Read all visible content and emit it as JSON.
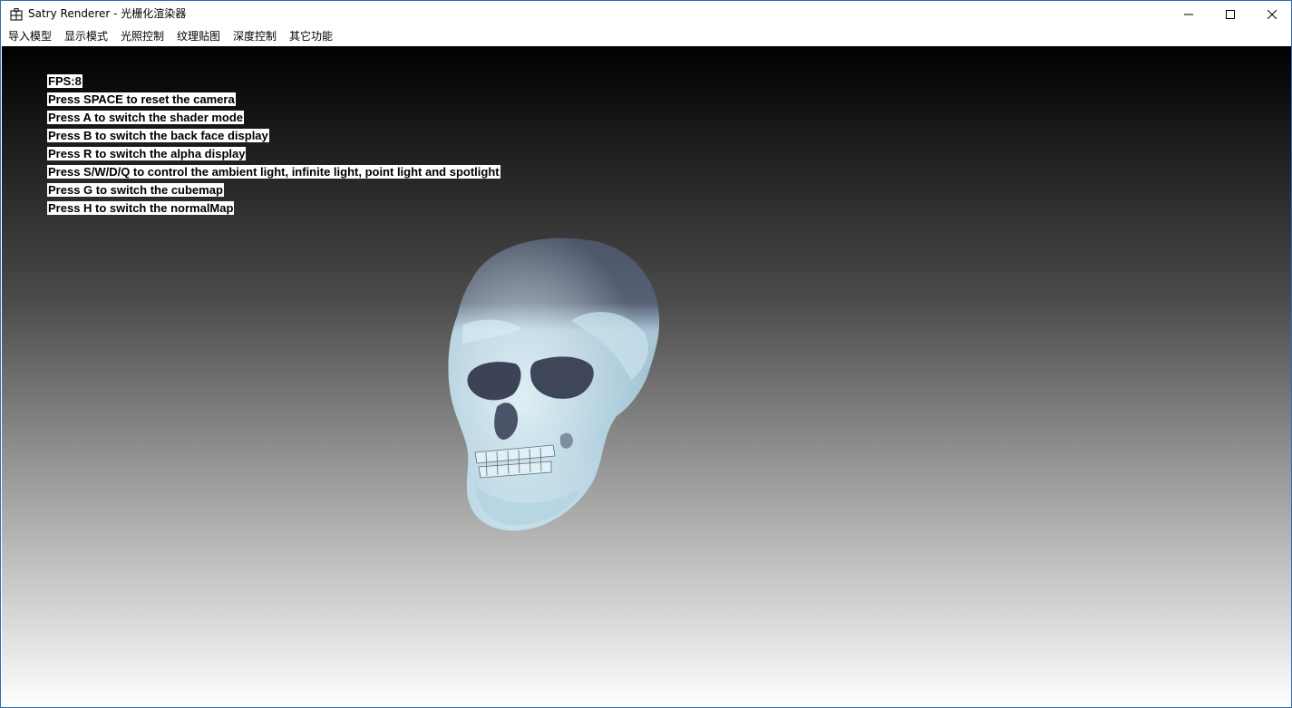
{
  "window": {
    "title": "Satry Renderer - 光栅化渲染器",
    "app_icon": "app-window-icon",
    "controls": {
      "minimize_icon": "minimize-icon",
      "maximize_icon": "maximize-icon",
      "close_icon": "close-icon"
    }
  },
  "menu": {
    "items": [
      {
        "label": "导入模型"
      },
      {
        "label": "显示模式"
      },
      {
        "label": "光照控制"
      },
      {
        "label": "纹理贴图"
      },
      {
        "label": "深度控制"
      },
      {
        "label": "其它功能"
      }
    ]
  },
  "overlay": {
    "fps": "FPS:8",
    "lines": [
      "Press SPACE to reset the camera",
      "Press A to switch the shader mode",
      "Press B to switch the back face display",
      "Press R to switch the alpha display",
      "Press S/W/D/Q to control the ambient light, infinite light, point light and spotlight",
      "Press G to switch the cubemap",
      "Press H to switch the normalMap"
    ]
  },
  "colors": {
    "window_border": "#2b6fb3",
    "overlay_bg": "#ffffff",
    "overlay_text": "#000000",
    "skull_top": "#4d5568",
    "skull_face": "#9fc4d6"
  }
}
